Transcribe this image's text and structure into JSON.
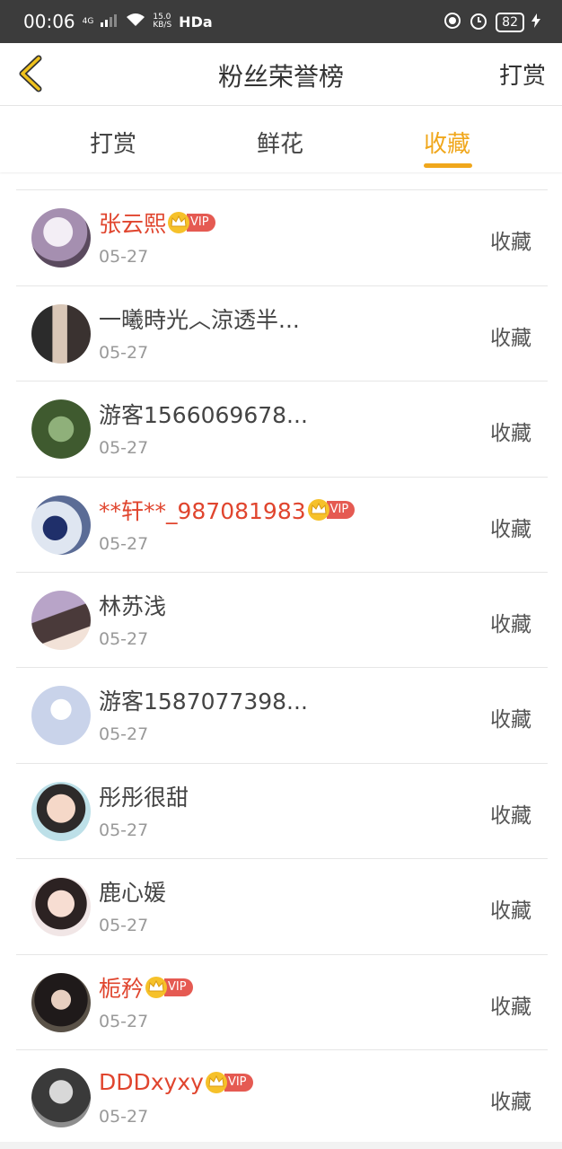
{
  "status_bar": {
    "time": "00:06",
    "network": "4G",
    "speed_value": "15.0",
    "speed_unit": "KB/S",
    "hd": "HDa",
    "battery": "82"
  },
  "header": {
    "title": "粉丝荣誉榜",
    "action": "打赏"
  },
  "tabs": [
    {
      "label": "打赏"
    },
    {
      "label": "鲜花"
    },
    {
      "label": "收藏",
      "active": true
    }
  ],
  "colors": {
    "accent": "#f0a71c",
    "vip_name": "#e0452e",
    "vip_tag": "#e55a52"
  },
  "list": [
    {
      "name": "",
      "date": "05-27",
      "vip": false,
      "action": "收藏"
    },
    {
      "name": "张云熙",
      "date": "05-27",
      "vip": true,
      "action": "收藏"
    },
    {
      "name": "一曦時光︿涼透半...",
      "date": "05-27",
      "vip": false,
      "action": "收藏"
    },
    {
      "name": "游客1566069678...",
      "date": "05-27",
      "vip": false,
      "action": "收藏"
    },
    {
      "name": "**轩**_987081983",
      "date": "05-27",
      "vip": true,
      "action": "收藏"
    },
    {
      "name": "林苏浅",
      "date": "05-27",
      "vip": false,
      "action": "收藏"
    },
    {
      "name": "游客1587077398...",
      "date": "05-27",
      "vip": false,
      "action": "收藏"
    },
    {
      "name": "彤彤很甜",
      "date": "05-27",
      "vip": false,
      "action": "收藏"
    },
    {
      "name": "鹿心媛",
      "date": "05-27",
      "vip": false,
      "action": "收藏"
    },
    {
      "name": "栀矜",
      "date": "05-27",
      "vip": true,
      "action": "收藏"
    },
    {
      "name": "DDDxyxy",
      "date": "05-27",
      "vip": true,
      "action": "收藏"
    }
  ],
  "vip_label": "VIP"
}
